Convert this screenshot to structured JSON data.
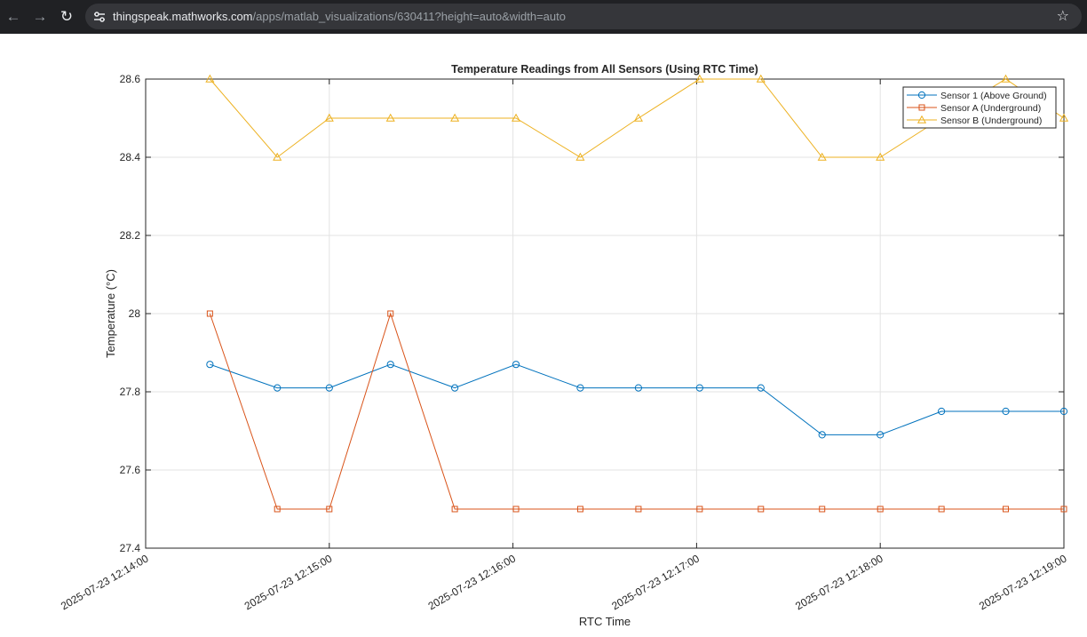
{
  "browser": {
    "url_host": "thingspeak.mathworks.com",
    "url_path": "/apps/matlab_visualizations/630411?height=auto&width=auto",
    "icons": [
      "back-arrow-icon",
      "forward-arrow-icon",
      "reload-icon",
      "site-info-icon",
      "bookmark-star-icon"
    ]
  },
  "chart_data": {
    "type": "line",
    "title": "Temperature Readings from All Sensors (Using RTC Time)",
    "xlabel": "RTC Time",
    "ylabel": "Temperature (°C)",
    "xlim": [
      "2025-07-23 12:14:00",
      "2025-07-23 12:19:00"
    ],
    "ylim": [
      27.4,
      28.6
    ],
    "grid": true,
    "legend": "top-right",
    "x_ticks": [
      "2025-07-23 12:14:00",
      "2025-07-23 12:15:00",
      "2025-07-23 12:16:00",
      "2025-07-23 12:17:00",
      "2025-07-23 12:18:00",
      "2025-07-23 12:19:00"
    ],
    "y_ticks": [
      "27.4",
      "27.6",
      "27.8",
      "28",
      "28.2",
      "28.4",
      "28.6"
    ],
    "x": [
      "2025-07-23 12:14:21",
      "2025-07-23 12:14:43",
      "2025-07-23 12:15:00",
      "2025-07-23 12:15:20",
      "2025-07-23 12:15:41",
      "2025-07-23 12:16:01",
      "2025-07-23 12:16:22",
      "2025-07-23 12:16:41",
      "2025-07-23 12:17:01",
      "2025-07-23 12:17:21",
      "2025-07-23 12:17:41",
      "2025-07-23 12:18:00",
      "2025-07-23 12:18:20",
      "2025-07-23 12:18:41",
      "2025-07-23 12:19:00"
    ],
    "series": [
      {
        "name": "Sensor 1 (Above Ground)",
        "color": "#0072BD",
        "marker": "circle",
        "values": [
          27.87,
          27.81,
          27.81,
          27.87,
          27.81,
          27.87,
          27.81,
          27.81,
          27.81,
          27.81,
          27.69,
          27.69,
          27.75,
          27.75,
          27.75
        ]
      },
      {
        "name": "Sensor A (Underground)",
        "color": "#D95319",
        "marker": "square",
        "values": [
          28.0,
          27.5,
          27.5,
          28.0,
          27.5,
          27.5,
          27.5,
          27.5,
          27.5,
          27.5,
          27.5,
          27.5,
          27.5,
          27.5,
          27.5
        ]
      },
      {
        "name": "Sensor B (Underground)",
        "color": "#EDB120",
        "marker": "triangle",
        "values": [
          28.6,
          28.4,
          28.5,
          28.5,
          28.5,
          28.5,
          28.4,
          28.5,
          28.6,
          28.6,
          28.4,
          28.4,
          28.5,
          28.6,
          28.5
        ]
      }
    ]
  }
}
